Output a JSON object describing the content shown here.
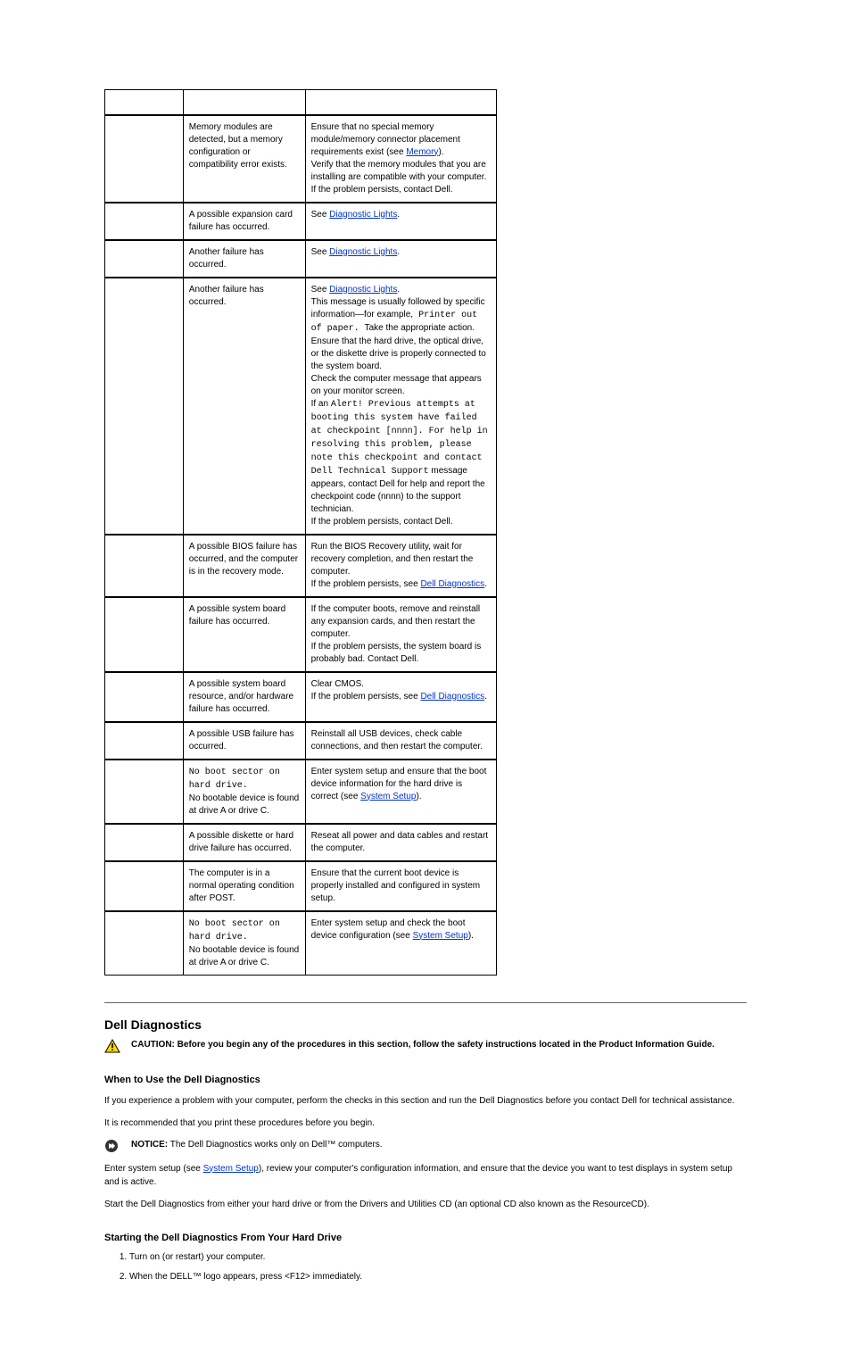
{
  "table": {
    "rows": [
      {
        "c1": {
          "lights": "g-g-y-y",
          "name": "",
          "flavor": ""
        },
        "c2": "",
        "c3": [],
        "flavor": "thin",
        "blank": true
      },
      {
        "c1": {
          "lights": "y-g-g-y",
          "name": "Memory modules are detected, but a memory configuration or compatibility error exists.",
          "flavor": ""
        },
        "c2": "Memory modules are detected, but a memory configuration or compatibility error exists.",
        "c3": [
          "Ensure that no special memory module/memory connector placement requirements exist (see ",
          "link:Memory",
          ").",
          "br",
          "Verify that the memory modules that you are installing are compatible with your computer.",
          "br",
          "If the problem persists, contact Dell."
        ],
        "flavor": "heavy"
      },
      {
        "c1": {
          "lights": "y-g-y-g"
        },
        "c2": "A possible expansion card failure has occurred.",
        "c3": [
          "See ",
          "link:Diagnostic Lights",
          "."
        ],
        "flavor": "heavy"
      },
      {
        "c1": {
          "lights": "y-g-g-g"
        },
        "c2": "Another failure has occurred.",
        "c3": [
          "See ",
          "link:Diagnostic Lights",
          "."
        ],
        "flavor": "heavy"
      },
      {
        "c1": {
          "lights": "y-g-g-g"
        },
        "c2": "Another failure has occurred.",
        "c3_long": true,
        "flavor": "heavy"
      },
      {
        "c1": {
          "lights": "g-y-y-y"
        },
        "c2": "A possible BIOS failure has occurred, and  the computer is in the recovery mode.",
        "c3": [
          "Run the BIOS Recovery utility, wait for recovery completion, and then restart the computer.",
          "br",
          "If the problem persists, see ",
          "link:Dell Diagnostics",
          "."
        ],
        "flavor": "heavy"
      },
      {
        "c1": {
          "lights": "g-y-y-g"
        },
        "c2": "A possible system board failure has occurred.",
        "c3": [
          "If the computer boots, remove and reinstall any expansion cards, and then restart the computer.",
          "br",
          "If the problem persists, the system board is probably bad. Contact Dell."
        ],
        "flavor": "heavy"
      },
      {
        "c1": {
          "lights": "g-y-g-y"
        },
        "c2": "A possible system board resource, and/or hardware failure has occurred.",
        "c3": [
          "Clear CMOS.",
          "br",
          "If the problem persists, see ",
          "link:Dell Diagnostics",
          "."
        ],
        "flavor": "heavy"
      },
      {
        "c1": {
          "lights": "g-y-g-g"
        },
        "c2": "A possible USB failure has occurred.",
        "c3": [
          "Reinstall all USB devices, check cable connections, and then restart the computer."
        ],
        "flavor": "heavy"
      },
      {
        "c1": {
          "lights": "g-g-y-g"
        },
        "c2_pre": "No boot sector on hard drive.",
        "c2_post": "No bootable device is found at drive A or drive C.",
        "c3": [
          "Enter system setup and ensure that the boot device information for the hard drive is correct (see ",
          "link:System Setup",
          ")."
        ],
        "flavor": "heavy"
      },
      {
        "c1": {
          "lights": "g-g-g-y"
        },
        "c2": "A possible diskette or hard drive failure has occurred.",
        "c3": [
          "Reseat all power and data cables and restart the computer."
        ],
        "flavor": "heavy"
      },
      {
        "c1": {
          "lights": "g-g-y-y"
        },
        "c2": "The computer is in a normal operating condition after POST.",
        "c3": [
          "Ensure that the current boot device is properly installed and configured in system setup."
        ],
        "flavor": "heavy"
      },
      {
        "c1": {
          "lights": "g-g-y-y"
        },
        "c2_pre": "No boot sector on hard drive.",
        "c2_post": "No bootable device is found at drive A or drive C.",
        "c3": [
          "Enter system setup and check the boot device configuration (see ",
          "link:System Setup",
          ")."
        ],
        "flavor": "heavy"
      }
    ]
  },
  "section": {
    "title": "Dell Diagnostics",
    "caution": "CAUTION: Before you begin any of the procedures in this section, follow the safety instructions located in the Product Information Guide.",
    "when_title": "When to Use the Dell Diagnostics",
    "when_body1": "If you experience a problem with your computer, perform the checks in this section and run the Dell Diagnostics before you contact Dell for technical assistance.",
    "when_body2": "It is recommended that you print these procedures before you begin.",
    "notice": "NOTICE:",
    "notice_body": "The Dell Diagnostics works only on Dell™ computers.",
    "enter_setup_pre": "Enter system setup (see ",
    "enter_setup_link": "System Setup",
    "enter_setup_post": "), review your computer's configuration information, and ensure that the device you want to test displays in system setup and is active.",
    "start_body": "Start the Dell Diagnostics from either your hard drive or from the Drivers and Utilities CD (an optional CD also known as the ResourceCD).",
    "start_hd_title": "Starting the Dell Diagnostics From Your Hard Drive",
    "steps": [
      "Turn on (or restart) your computer.",
      "When the DELL™ logo appears, press <F12> immediately."
    ]
  },
  "links": {
    "memory": "Memory",
    "diag_lights": "Diagnostic Lights",
    "dell_diag": "Dell Diagnostics",
    "system_setup": "System Setup"
  },
  "c3_long": {
    "t1": "See ",
    "t1l": "Diagnostic Lights",
    "t1b": ".",
    "t2": "This message is usually followed by specific information—for example,",
    "t2code": " Printer out of paper. ",
    "t2a": "Take the appropriate action.",
    "t3": "Ensure that the hard drive, the optical drive, or the diskette drive is properly connected to the system board.",
    "t4": "Check the computer message that appears on your monitor screen.",
    "t5pre": "If an ",
    "t5code1": "Alert! Previous attempts at booting this system have failed at checkpoint [nnnn]. For help in resolving this problem, please note this checkpoint and contact Dell Technical Support",
    "t5post": " message appears, contact Dell for help and report the checkpoint code (nnnn) to the support technician.",
    "t6": "If the problem persists, contact Dell."
  }
}
